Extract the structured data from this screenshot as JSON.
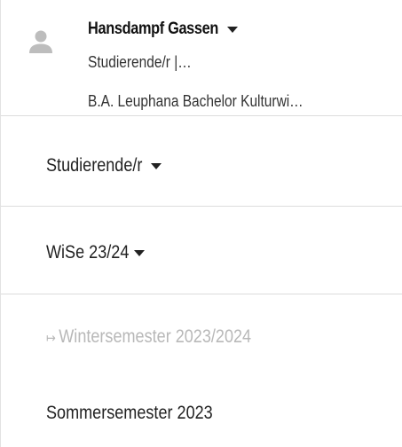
{
  "user": {
    "name": "Hansdampf Gassen",
    "role_short": "Studierende/r  |…",
    "program": "B.A. Leuphana Bachelor Kulturwi…",
    "avatar_icon": "person-icon"
  },
  "role_selector": {
    "label": "Studierende/r"
  },
  "semester_selector": {
    "label": "WiSe 23/24"
  },
  "semester_list": {
    "items": [
      {
        "arrow": "↦",
        "label": "Wintersemester 2023/2024",
        "state": "current"
      },
      {
        "label": "Sommersemester 2023",
        "state": "selectable"
      }
    ]
  },
  "colors": {
    "text": "#222222",
    "muted": "#b8b8b8",
    "divider": "#dcdcdc",
    "avatar": "#bdbdbd"
  }
}
